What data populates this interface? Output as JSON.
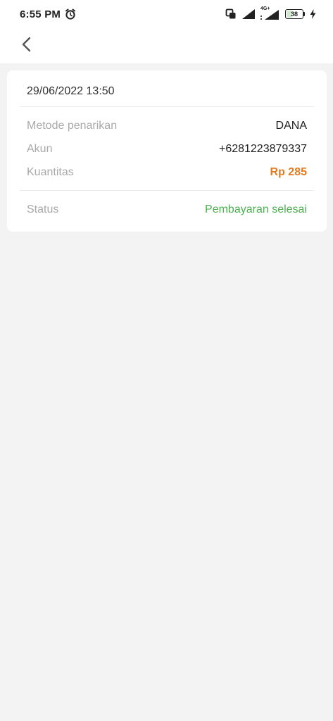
{
  "status_bar": {
    "time": "6:55 PM",
    "network_label": "4G+",
    "battery_level": "38",
    "battery_fraction": 0.38,
    "icons": [
      "alarm-icon",
      "screen-mirror-icon",
      "signal-icon",
      "signal-4g-icon",
      "battery-icon",
      "charging-icon"
    ]
  },
  "header": {
    "back_icon": "chevron-left-icon"
  },
  "transaction": {
    "datetime": "29/06/2022 13:50",
    "rows": [
      {
        "label": "Metode penarikan",
        "value": "DANA"
      },
      {
        "label": "Akun",
        "value": "+6281223879337"
      },
      {
        "label": "Kuantitas",
        "value": "Rp 285"
      }
    ],
    "status_label": "Status",
    "status_value": "Pembayaran selesai"
  },
  "colors": {
    "amount": "#e47a1f",
    "status_success": "#4caf50",
    "label": "#a9a9a9",
    "background": "#f3f3f3"
  }
}
